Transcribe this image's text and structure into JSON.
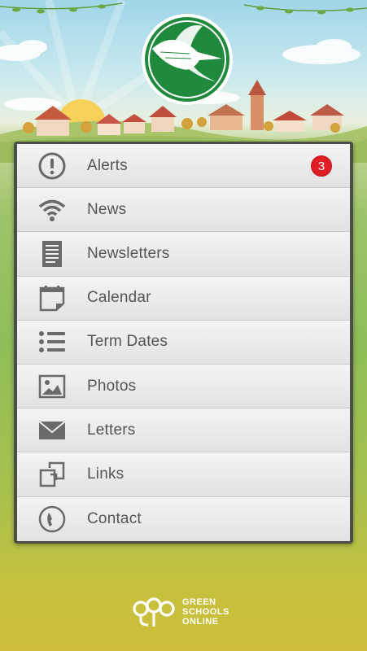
{
  "menu": {
    "items": [
      {
        "label": "Alerts",
        "icon": "alert-icon",
        "badge": "3"
      },
      {
        "label": "News",
        "icon": "wifi-icon"
      },
      {
        "label": "Newsletters",
        "icon": "document-icon"
      },
      {
        "label": "Calendar",
        "icon": "calendar-icon"
      },
      {
        "label": "Term Dates",
        "icon": "list-icon"
      },
      {
        "label": "Photos",
        "icon": "image-icon"
      },
      {
        "label": "Letters",
        "icon": "envelope-icon"
      },
      {
        "label": "Links",
        "icon": "link-icon"
      },
      {
        "label": "Contact",
        "icon": "phone-icon"
      }
    ]
  },
  "footer": {
    "line1": "GREEN",
    "line2": "SCHOOLS",
    "line3": "ONLINE"
  },
  "colors": {
    "badge": "#e01e25",
    "logo_green": "#1f8a3c",
    "icon_gray": "#6a6a6a"
  }
}
